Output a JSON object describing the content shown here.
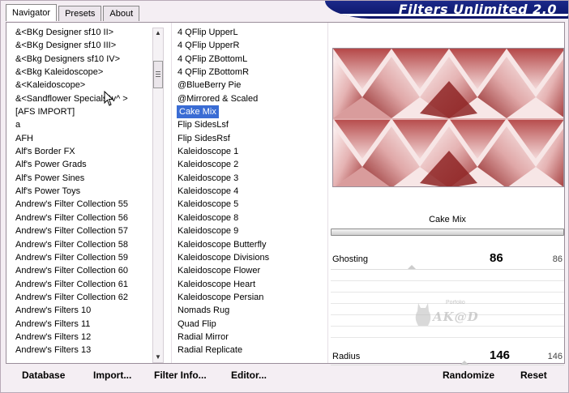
{
  "app": {
    "title": "Filters Unlimited 2.0"
  },
  "tabs": [
    {
      "label": "Navigator",
      "active": true
    },
    {
      "label": "Presets",
      "active": false
    },
    {
      "label": "About",
      "active": false
    }
  ],
  "categories": [
    "&<BKg Designer sf10 II>",
    "&<BKg Designer sf10 III>",
    "&<Bkg Designers sf10 IV>",
    "&<Bkg Kaleidoscope>",
    "&<Kaleidoscope>",
    "&<Sandflower Specials^v^ >",
    "[AFS IMPORT]",
    "a",
    "AFH",
    "Alf's Border FX",
    "Alf's Power Grads",
    "Alf's Power Sines",
    "Alf's Power Toys",
    "Andrew's Filter Collection 55",
    "Andrew's Filter Collection 56",
    "Andrew's Filter Collection 57",
    "Andrew's Filter Collection 58",
    "Andrew's Filter Collection 59",
    "Andrew's Filter Collection 60",
    "Andrew's Filter Collection 61",
    "Andrew's Filter Collection 62",
    "Andrew's Filters 10",
    "Andrew's Filters 11",
    "Andrew's Filters 12",
    "Andrew's Filters 13"
  ],
  "filters": [
    "4 QFlip UpperL",
    "4 QFlip UpperR",
    "4 QFlip ZBottomL",
    "4 QFlip ZBottomR",
    "@BlueBerry Pie",
    "@Mirrored & Scaled",
    "Cake Mix",
    "Flip SidesLsf",
    "Flip SidesRsf",
    "Kaleidoscope 1",
    "Kaleidoscope 2",
    "Kaleidoscope 3",
    "Kaleidoscope 4",
    "Kaleidoscope 5",
    "Kaleidoscope 8",
    "Kaleidoscope 9",
    "Kaleidoscope Butterfly",
    "Kaleidoscope Divisions",
    "Kaleidoscope Flower",
    "Kaleidoscope Heart",
    "Kaleidoscope Persian",
    "Nomads Rug",
    "Quad Flip",
    "Radial Mirror",
    "Radial Replicate"
  ],
  "selected_filter_index": 6,
  "preview": {
    "filter_name": "Cake Mix"
  },
  "params": [
    {
      "label": "Ghosting",
      "value": "86",
      "max": "86"
    },
    {
      "label": "Radius",
      "value": "146",
      "max": "146"
    }
  ],
  "logo": {
    "text": "AK@D",
    "small": "Porfolio"
  },
  "buttons": {
    "database": "Database",
    "import": "Import...",
    "filter_info": "Filter Info...",
    "editor": "Editor...",
    "randomize": "Randomize",
    "reset": "Reset"
  },
  "colors": {
    "accent": "#3a6cd4",
    "banner": "#0a1466",
    "preview_red": "#9c2c2c"
  }
}
